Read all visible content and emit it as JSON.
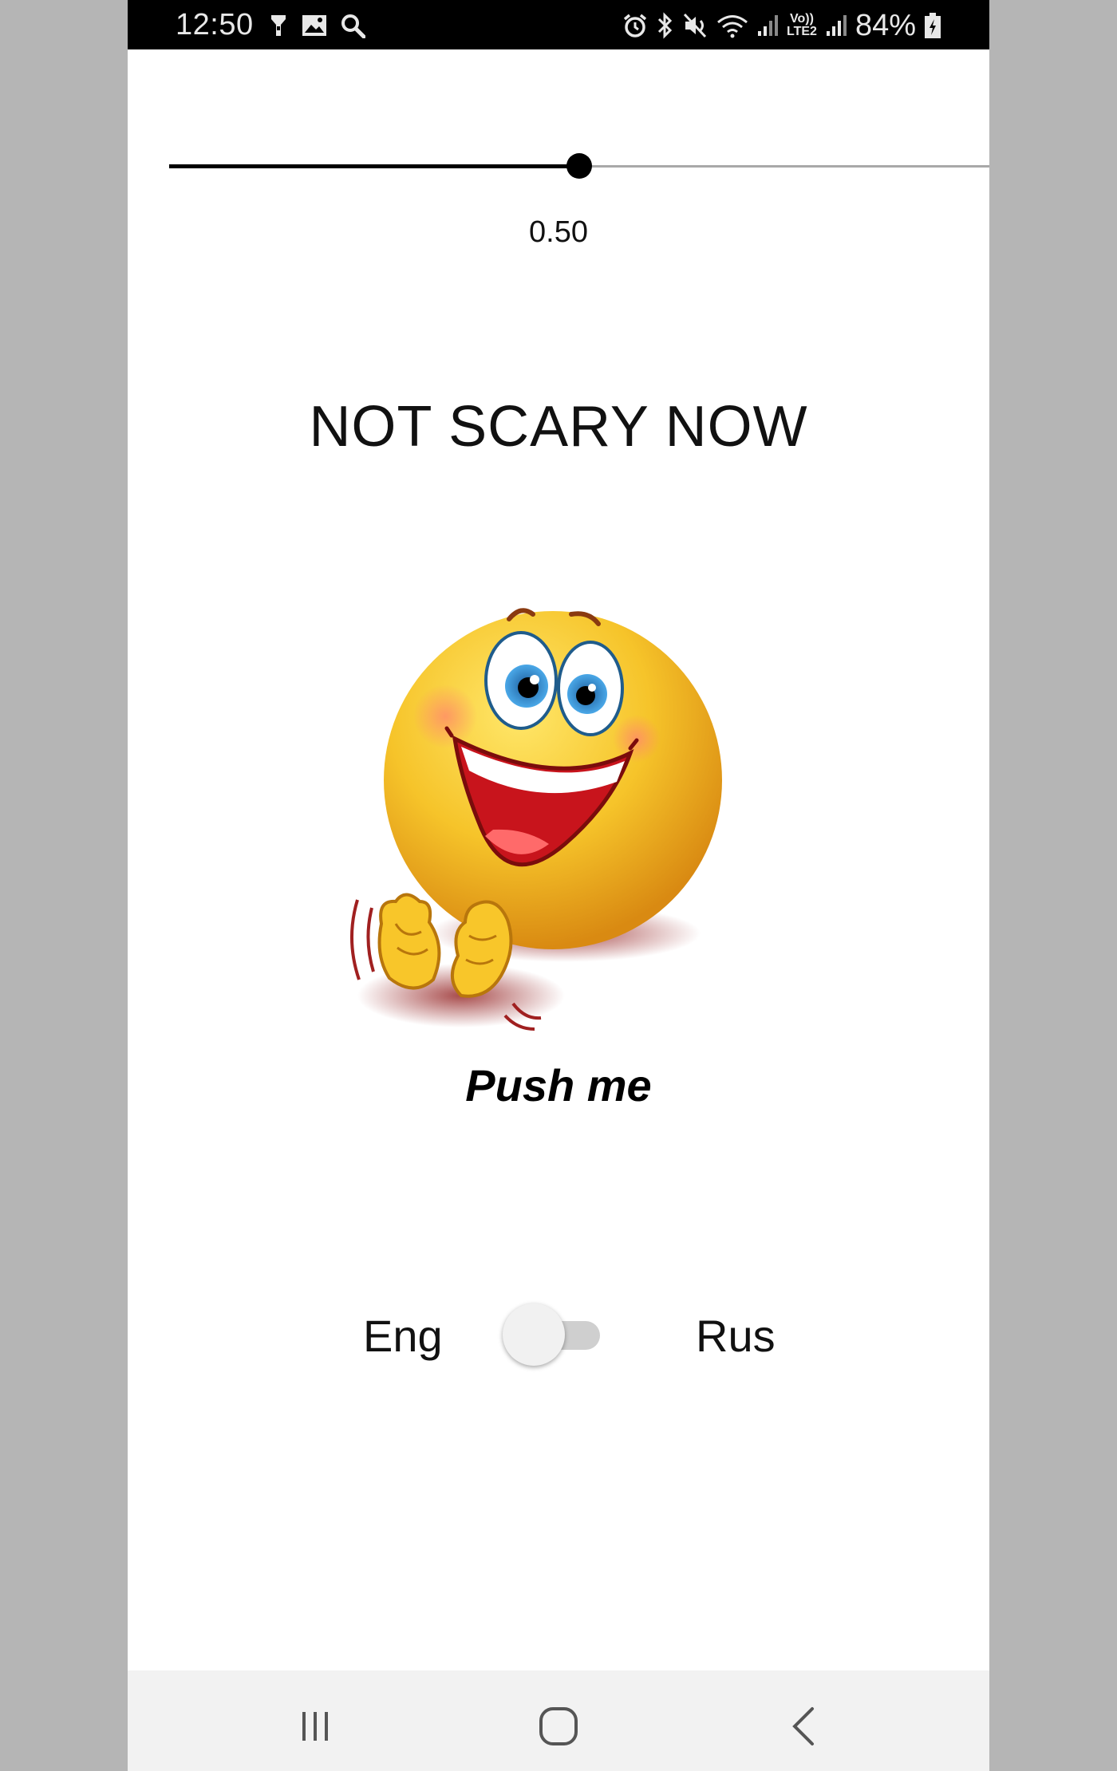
{
  "status_bar": {
    "time": "12:50",
    "left_icons": [
      "flashlight-icon",
      "gallery-icon",
      "search-icon"
    ],
    "right_icons": [
      "alarm-icon",
      "bluetooth-icon",
      "mute-icon",
      "wifi-icon",
      "signal-icon",
      "volte-icon",
      "signal-icon",
      "battery-icon"
    ],
    "volte_top": "Vo))",
    "volte_bottom": "LTE2",
    "battery": "84%"
  },
  "slider": {
    "value": 0.5,
    "value_label": "0.50",
    "active_color": "#000000",
    "inactive_color": "#a8a8a8"
  },
  "headline": "NOT SCARY NOW",
  "emoji": {
    "icon": "laughing-clapping-emoji"
  },
  "push_button": {
    "label": "Push me"
  },
  "language": {
    "left_label": "Eng",
    "right_label": "Rus",
    "toggle_on": false
  },
  "nav_bar": {
    "buttons": [
      "recents-icon",
      "home-icon",
      "back-icon"
    ]
  }
}
